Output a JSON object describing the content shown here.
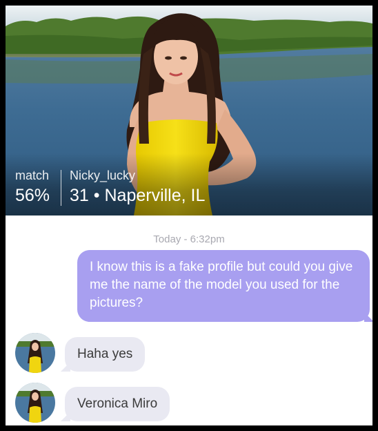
{
  "profile": {
    "match_label": "match",
    "match_value": "56%",
    "username": "Nicky_lucky",
    "age": "31",
    "separator": "•",
    "location": "Naperville, IL"
  },
  "chat": {
    "timestamp": "Today - 6:32pm",
    "messages": [
      {
        "direction": "outgoing",
        "text": "I know this is a fake profile but could you give me the name of the model you used for the pictures?"
      },
      {
        "direction": "incoming",
        "text": "Haha yes"
      },
      {
        "direction": "incoming",
        "text": "Veronica Miro"
      }
    ]
  },
  "colors": {
    "outgoing_bubble": "#a89ff0",
    "incoming_bubble": "#e9e9f2",
    "timestamp": "#a8a8b0"
  }
}
